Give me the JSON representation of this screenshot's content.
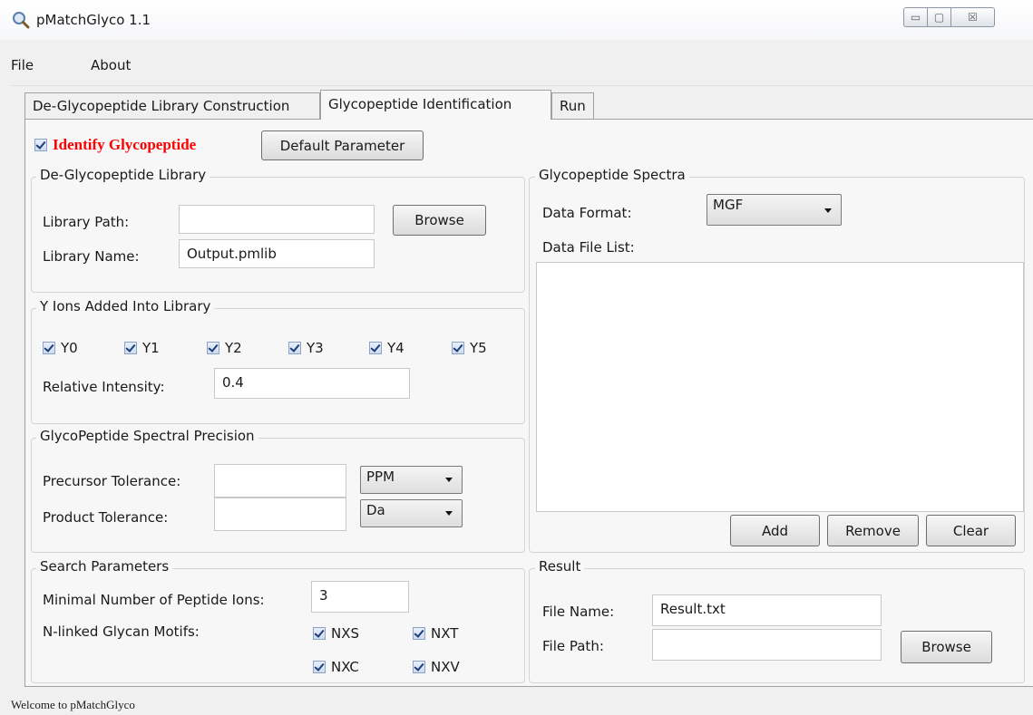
{
  "window": {
    "title": "pMatchGlyco 1.1",
    "controls": {
      "minimize": "▭",
      "maximize": "▢",
      "close": "☒"
    }
  },
  "menu": {
    "items": [
      "File",
      "About"
    ]
  },
  "tabs": [
    {
      "label": "De-Glycopeptide Library Construction",
      "active": false
    },
    {
      "label": "Glycopeptide Identification",
      "active": true
    },
    {
      "label": "Run",
      "active": false
    }
  ],
  "identify": {
    "label": "Identify Glycopeptide",
    "checked": true,
    "color": "#ff0000"
  },
  "default_parameter_button": "Default Parameter",
  "library": {
    "title": "De-Glycopeptide Library",
    "path_label": "Library Path:",
    "path_value": "",
    "browse_label": "Browse",
    "name_label": "Library Name:",
    "name_value": "Output.pmlib"
  },
  "y_ions": {
    "title": "Y Ions Added Into Library",
    "items": [
      {
        "label": "Y0",
        "checked": true
      },
      {
        "label": "Y1",
        "checked": true
      },
      {
        "label": "Y2",
        "checked": true
      },
      {
        "label": "Y3",
        "checked": true
      },
      {
        "label": "Y4",
        "checked": true
      },
      {
        "label": "Y5",
        "checked": true
      }
    ],
    "intensity_label": "Relative Intensity:",
    "intensity_value": "0.4"
  },
  "precision": {
    "title": "GlycoPeptide Spectral Precision",
    "precursor_label": "Precursor Tolerance:",
    "precursor_value": "",
    "precursor_unit": "PPM",
    "product_label": "Product Tolerance:",
    "product_value": "",
    "product_unit": "Da"
  },
  "search": {
    "title": "Search Parameters",
    "min_ions_label": "Minimal Number of Peptide Ions:",
    "min_ions_value": "3",
    "motifs_label": "N-linked Glycan Motifs:",
    "motifs": [
      {
        "label": "NXS",
        "checked": true
      },
      {
        "label": "NXT",
        "checked": true
      },
      {
        "label": "NXC",
        "checked": true
      },
      {
        "label": "NXV",
        "checked": true
      }
    ]
  },
  "spectra": {
    "title": "Glycopeptide Spectra",
    "format_label": "Data Format:",
    "format_value": "MGF",
    "file_list_label": "Data File List:",
    "add_label": "Add",
    "remove_label": "Remove",
    "clear_label": "Clear"
  },
  "result": {
    "title": "Result",
    "file_name_label": "File Name:",
    "file_name_value": "Result.txt",
    "file_path_label": "File Path:",
    "file_path_value": "",
    "browse_label": "Browse"
  },
  "status": {
    "text": "Welcome to pMatchGlyco"
  }
}
